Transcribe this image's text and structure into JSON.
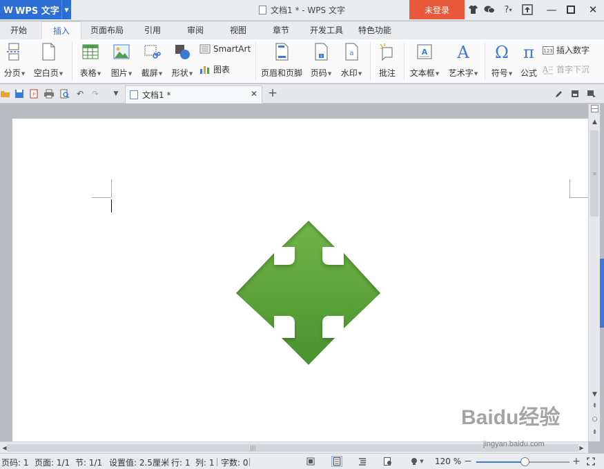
{
  "app": {
    "name": "WPS 文字",
    "window_title": "文档1 * - WPS 文字",
    "login_label": "未登录"
  },
  "tabs": [
    {
      "label": "开始"
    },
    {
      "label": "插入",
      "active": true
    },
    {
      "label": "页面布局"
    },
    {
      "label": "引用"
    },
    {
      "label": "审阅"
    },
    {
      "label": "视图"
    },
    {
      "label": "章节"
    },
    {
      "label": "开发工具"
    },
    {
      "label": "特色功能"
    }
  ],
  "ribbon": {
    "page_break": "分页",
    "blank_page": "空白页",
    "table": "表格",
    "picture": "图片",
    "screenshot": "截屏",
    "shapes": "形状",
    "smartart": "SmartArt",
    "chart": "图表",
    "header_footer": "页眉和页脚",
    "page_number": "页码",
    "watermark": "水印",
    "comment": "批注",
    "textbox": "文本框",
    "wordart": "艺术字",
    "symbol": "符号",
    "equation": "公式",
    "insert_number": "插入数字",
    "drop_cap": "首字下沉"
  },
  "doc_tab": {
    "label": "文档1 *"
  },
  "status": {
    "page_num": "页码: 1",
    "pages": "页面: 1/1",
    "section": "节: 1/1",
    "setting": "设置值: 2.5厘米",
    "row": "行: 1",
    "col": "列: 1",
    "word_count": "字数: 0",
    "zoom": "120 %",
    "zoom_fraction": 0.52
  },
  "watermark": {
    "text": "Baidu经验",
    "url": "jingyan.baidu.com"
  },
  "colors": {
    "accent": "#2d6ed5",
    "login": "#e8583a",
    "shape_green": "#5ba33a"
  }
}
